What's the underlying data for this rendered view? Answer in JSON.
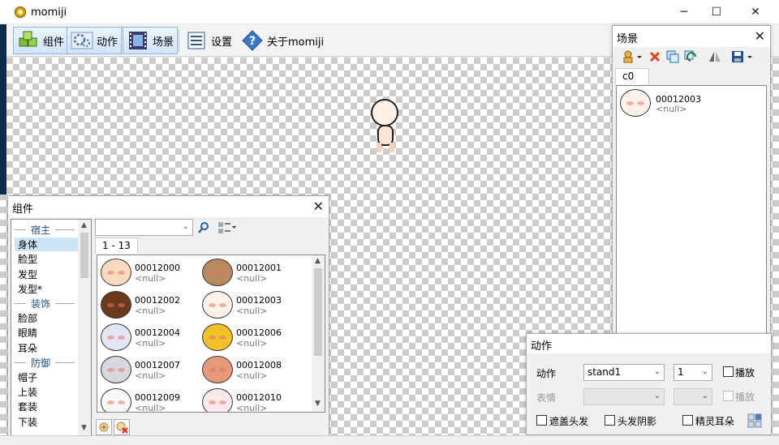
{
  "window": {
    "title": "momiji"
  },
  "toolbar": {
    "components": "组件",
    "actions": "动作",
    "scene": "场景",
    "settings": "设置",
    "about": "关于momiji"
  },
  "components_panel": {
    "title": "组件",
    "categories": [
      {
        "label": "宿主",
        "header": true
      },
      {
        "label": "身体",
        "selected": true
      },
      {
        "label": "脸型"
      },
      {
        "label": "发型"
      },
      {
        "label": "发型*"
      },
      {
        "label": "装饰",
        "header": true
      },
      {
        "label": "脸部"
      },
      {
        "label": "眼睛"
      },
      {
        "label": "耳朵"
      },
      {
        "label": "防御",
        "header": true
      },
      {
        "label": "帽子"
      },
      {
        "label": "上装"
      },
      {
        "label": "套装"
      },
      {
        "label": "下装"
      }
    ],
    "search_value": "",
    "page_tab": "1 - 13",
    "items": [
      {
        "code": "00012000",
        "sub": "<null>",
        "color": "#f9dcc0"
      },
      {
        "code": "00012001",
        "sub": "<null>",
        "color": "#b98a5e"
      },
      {
        "code": "00012002",
        "sub": "<null>",
        "color": "#6b3a1c"
      },
      {
        "code": "00012003",
        "sub": "<null>",
        "color": "#fff2ea"
      },
      {
        "code": "00012004",
        "sub": "<null>",
        "color": "#e4e6f6"
      },
      {
        "code": "00012006",
        "sub": "<null>",
        "color": "#f2c226"
      },
      {
        "code": "00012007",
        "sub": "<null>",
        "color": "#d6d8de"
      },
      {
        "code": "00012008",
        "sub": "<null>",
        "color": "#e69a78"
      },
      {
        "code": "00012009",
        "sub": "<null>",
        "color": "#f8f8f8"
      },
      {
        "code": "00012010",
        "sub": "<null>",
        "color": "#fde8ec"
      }
    ]
  },
  "scene_panel": {
    "title": "场景",
    "tab": "c0",
    "item": {
      "code": "00012003",
      "sub": "<null>",
      "color": "#fff2ea"
    }
  },
  "action_panel": {
    "title": "动作",
    "action_label": "动作",
    "action_value": "stand1",
    "frame_value": "1",
    "play_label": "播放",
    "expression_label": "表情",
    "expression_value": "",
    "expression_frame": "",
    "play2_label": "播放",
    "cover_hair_label": "遮盖头发",
    "hair_shadow_label": "头发阴影",
    "elf_ears_label": "精灵耳朵"
  }
}
